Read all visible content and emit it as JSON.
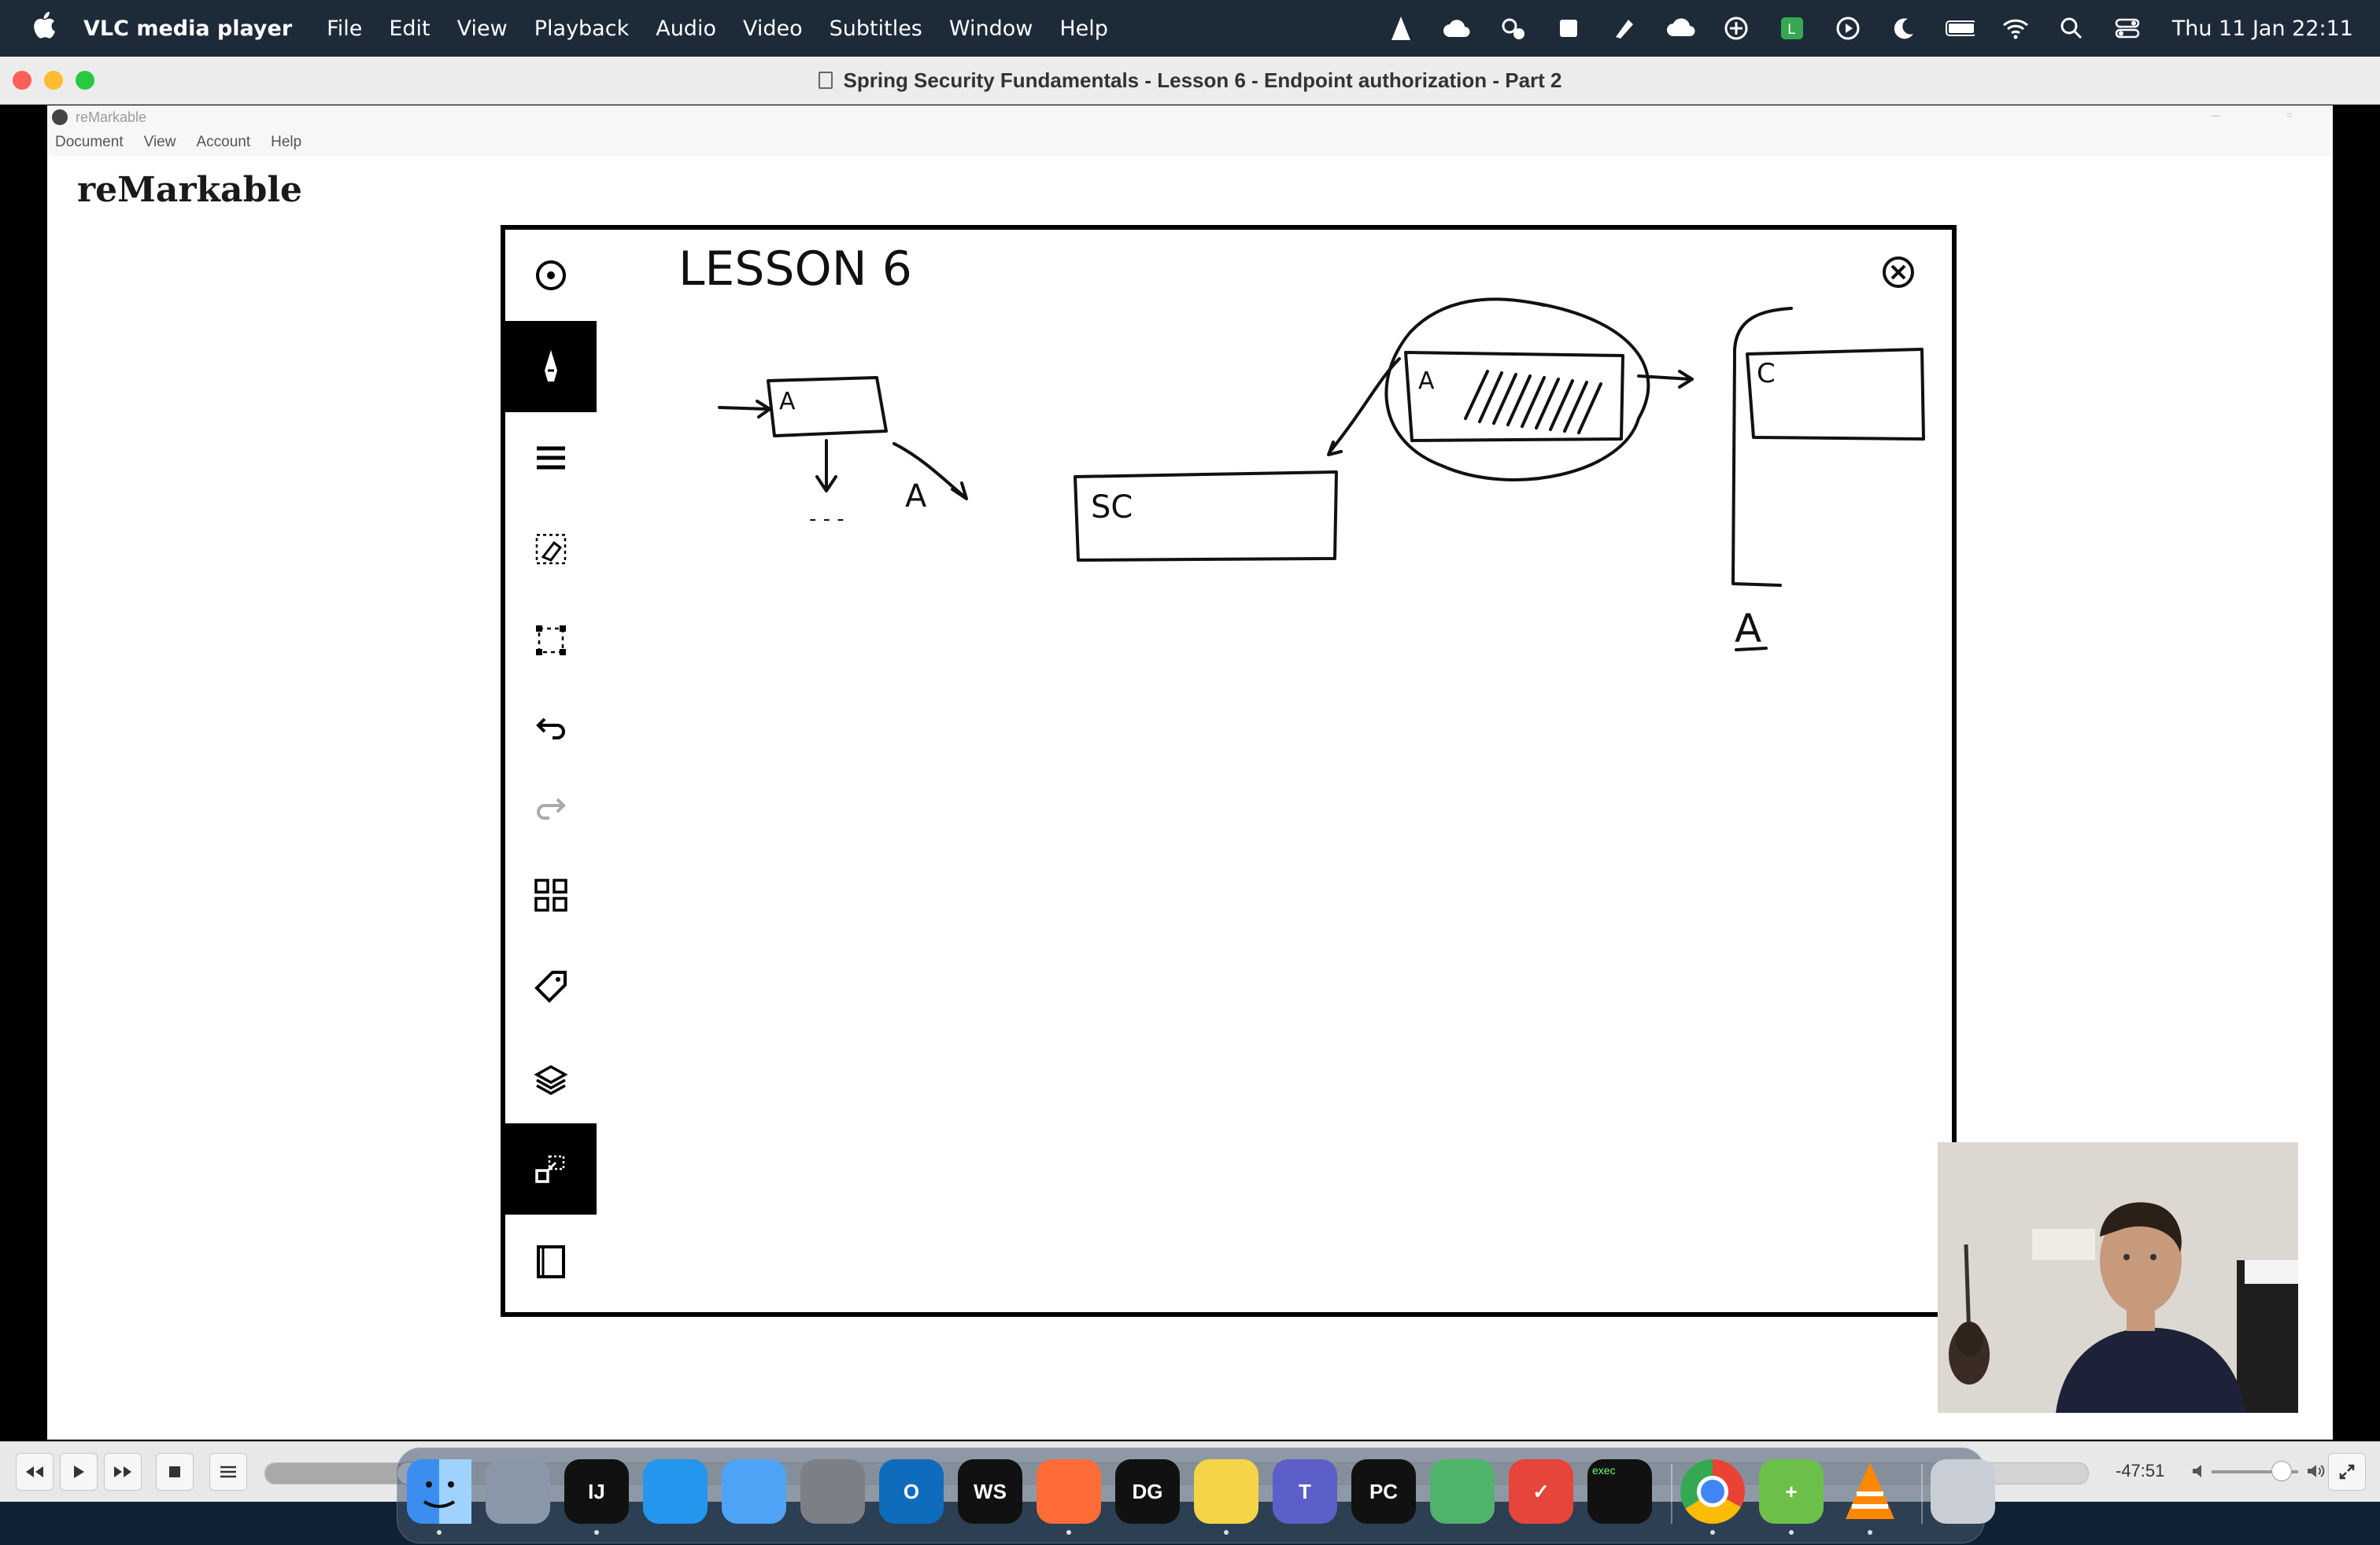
{
  "menubar": {
    "app_name": "VLC media player",
    "menus": [
      "File",
      "Edit",
      "View",
      "Playback",
      "Audio",
      "Video",
      "Subtitles",
      "Window",
      "Help"
    ],
    "clock": "Thu 11 Jan  22:11"
  },
  "window": {
    "title": "Spring Security Fundamentals - Lesson 6 - Endpoint authorization - Part 2"
  },
  "remarkable": {
    "window_title": "reMarkable",
    "menus": [
      "Document",
      "View",
      "Account",
      "Help"
    ],
    "brand": "reMarkable",
    "heading": "LESSON 6",
    "labels": {
      "box_a": "A",
      "arrow_a": "A",
      "box_sc": "SC",
      "box_a2": "A",
      "box_c": "C",
      "under_a": "A",
      "dash": "- - -"
    },
    "tools": [
      "menu-circle-icon",
      "pen-icon",
      "hamburger-icon",
      "eraser-selection-icon",
      "selection-icon",
      "undo-icon",
      "redo-icon",
      "grid-icon",
      "tag-icon",
      "layers-icon",
      "screen-share-icon",
      "notebook-icon"
    ]
  },
  "controls": {
    "time_remaining": "-47:51",
    "progress": 0.078,
    "volume": 0.8
  },
  "dock": {
    "apps": [
      {
        "name": "finder",
        "label": "",
        "color": "#3b8ef0"
      },
      {
        "name": "launchpad",
        "label": "",
        "color": "#8a97a8"
      },
      {
        "name": "intellij",
        "label": "IJ",
        "color": "#111111"
      },
      {
        "name": "docker",
        "label": "",
        "color": "#2496ed"
      },
      {
        "name": "mail",
        "label": "",
        "color": "#4fa3f7"
      },
      {
        "name": "system-settings",
        "label": "",
        "color": "#7c7f86"
      },
      {
        "name": "outlook",
        "label": "O",
        "color": "#0f6cbd"
      },
      {
        "name": "webstorm",
        "label": "WS",
        "color": "#111111"
      },
      {
        "name": "postman",
        "label": "",
        "color": "#ff6c37"
      },
      {
        "name": "datagrip",
        "label": "DG",
        "color": "#111111"
      },
      {
        "name": "notes",
        "label": "",
        "color": "#f5d547"
      },
      {
        "name": "teams",
        "label": "T",
        "color": "#5b5fc7"
      },
      {
        "name": "pycharm",
        "label": "PC",
        "color": "#111111"
      },
      {
        "name": "network-radar",
        "label": "",
        "color": "#4fb36a"
      },
      {
        "name": "tasks",
        "label": "✓",
        "color": "#e5453b"
      },
      {
        "name": "terminal",
        "label": "exec",
        "color": "#111111"
      },
      {
        "name": "chrome",
        "label": "",
        "color": "#ffffff"
      },
      {
        "name": "cloud-app",
        "label": "+",
        "color": "#6cc04a"
      },
      {
        "name": "vlc",
        "label": "",
        "color": "#ff8800"
      },
      {
        "name": "trash",
        "label": "",
        "color": "#c9ced6"
      }
    ]
  }
}
